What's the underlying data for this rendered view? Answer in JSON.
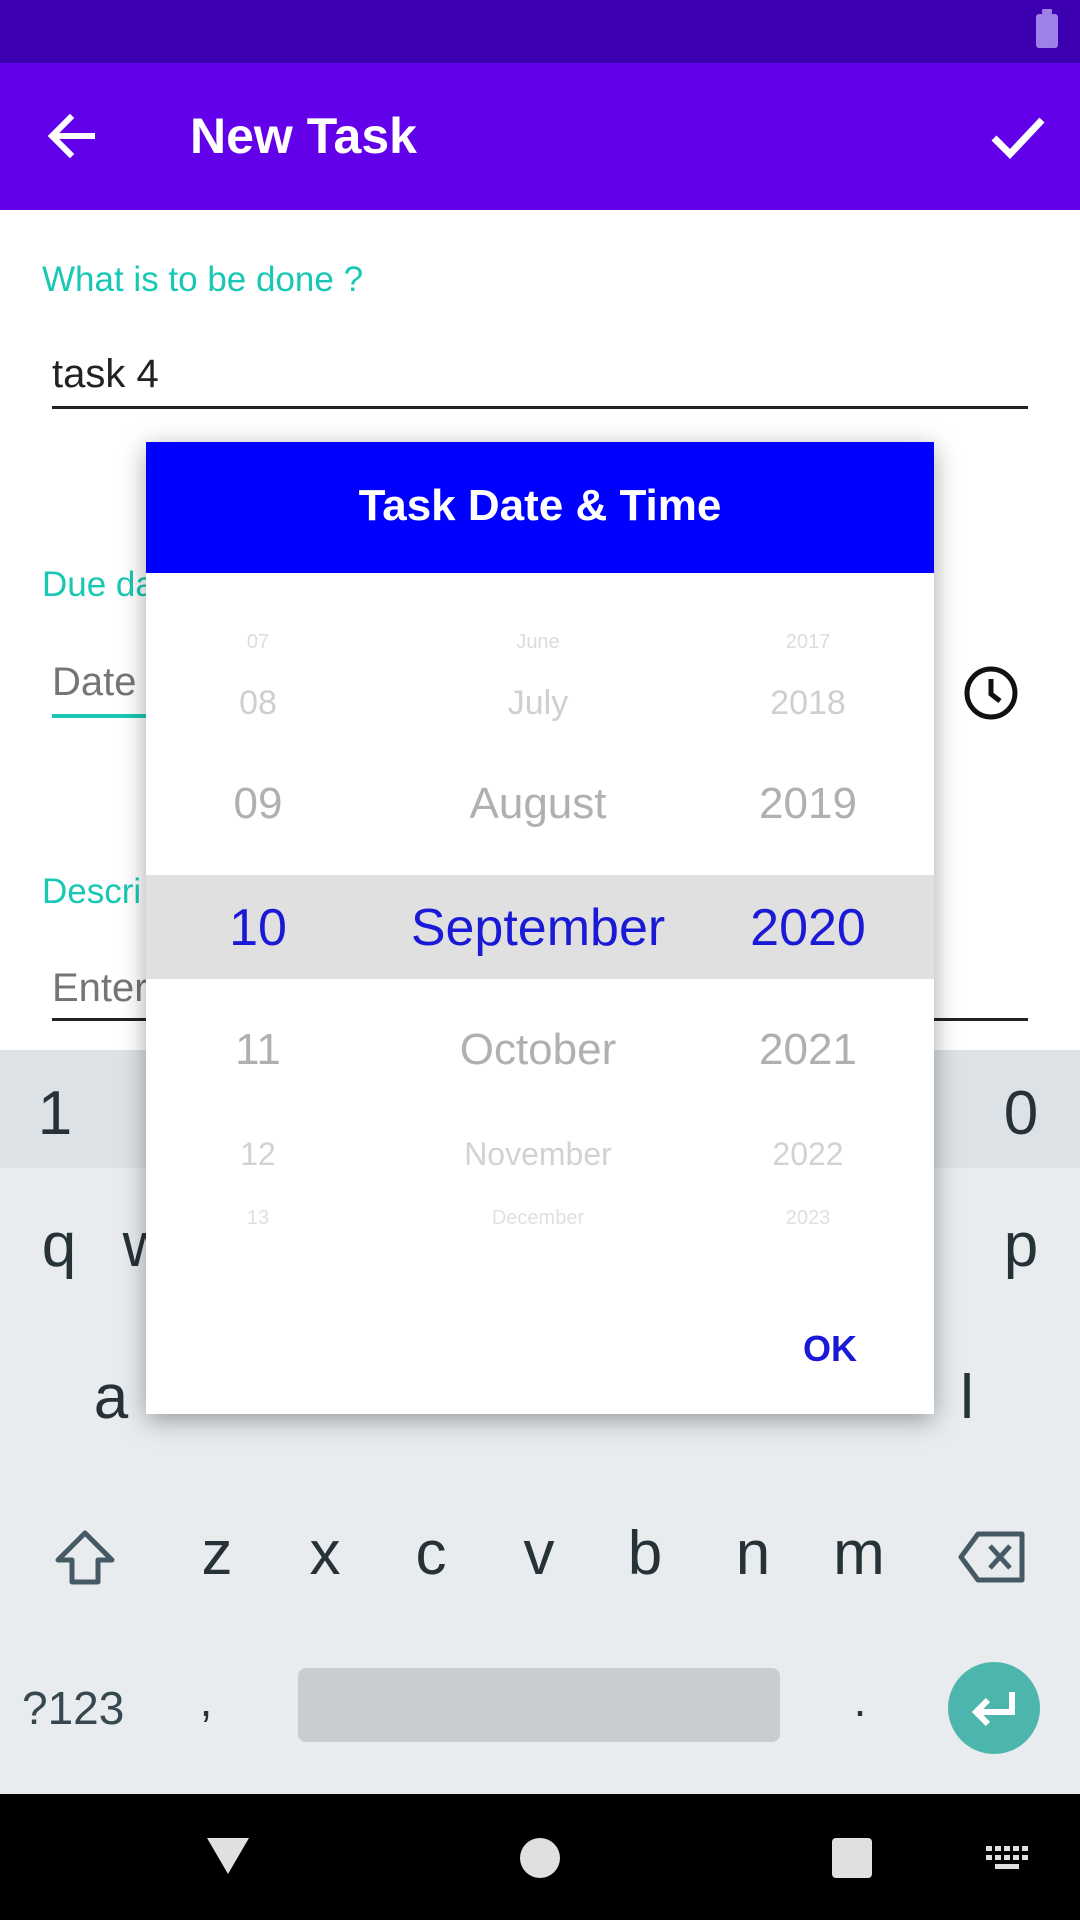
{
  "toolbar": {
    "title": "New Task",
    "back_icon": "arrow-back-icon",
    "confirm_icon": "check-icon"
  },
  "form": {
    "task_label": "What is to be done ?",
    "task_value": "task 4",
    "due_label": "Due da",
    "date_hint": "Date",
    "time_icon": "clock-icon",
    "description_label": "Descri",
    "description_hint": "Enter"
  },
  "dialog": {
    "title": "Task Date & Time",
    "days": [
      "07",
      "08",
      "09",
      "10",
      "11",
      "12",
      "13"
    ],
    "months": [
      "June",
      "July",
      "August",
      "September",
      "October",
      "November",
      "December"
    ],
    "years": [
      "2017",
      "2018",
      "2019",
      "2020",
      "2021",
      "2022",
      "2023"
    ],
    "selected": {
      "day": "10",
      "month": "September",
      "year": "2020"
    },
    "ok_label": "OK"
  },
  "keyboard": {
    "top_row_visible": [
      "1",
      "0"
    ],
    "row1_visible": [
      "q",
      "w",
      "p"
    ],
    "row2_visible": [
      "a",
      "l"
    ],
    "row3": [
      "z",
      "x",
      "c",
      "v",
      "b",
      "n",
      "m"
    ],
    "symbols_label": "?123",
    "comma": ",",
    "period": ".",
    "shift_icon": "shift-icon",
    "backspace_icon": "backspace-icon",
    "enter_icon": "enter-icon"
  },
  "navbar": {
    "back_icon": "nav-back-icon",
    "home_icon": "nav-home-icon",
    "recents_icon": "nav-recents-icon",
    "keyboard_icon": "keyboard-switch-icon"
  },
  "colors": {
    "status_bar": "#3d00b0",
    "toolbar": "#6200ea",
    "accent_teal": "#19c8b4",
    "dialog_header": "#0000ff",
    "picker_selected_text": "#1a1ad6",
    "enter_key": "#4db6ac"
  }
}
